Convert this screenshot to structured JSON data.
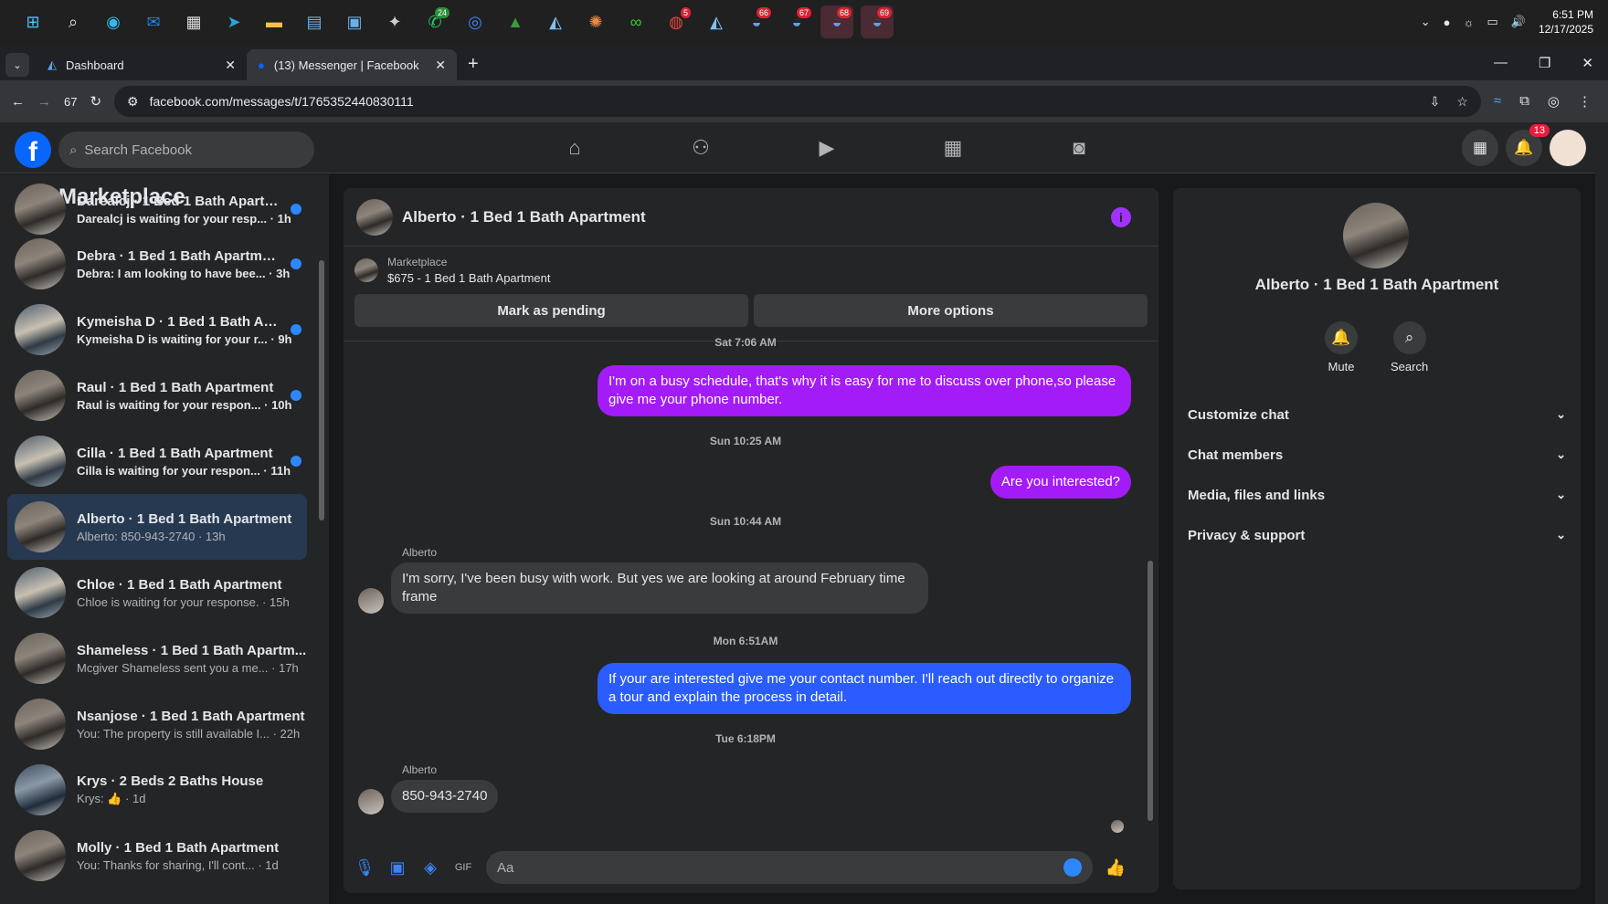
{
  "taskbar": {
    "time": "6:51 PM",
    "date": "12/17/2025",
    "whatsapp_badge": "24",
    "chrome_badge": "5",
    "app_badges": [
      "66",
      "67",
      "68",
      "69"
    ]
  },
  "browser": {
    "tabs": [
      {
        "label": "Dashboard"
      },
      {
        "label": "(13) Messenger | Facebook"
      }
    ],
    "url": "facebook.com/messages/t/1765352440830111",
    "counter": "67"
  },
  "facebook": {
    "search_placeholder": "Search Facebook",
    "notifications_count": "13"
  },
  "sidebar": {
    "title": "Marketplace",
    "items": [
      {
        "title": "Darealcj · 1 Bed 1 Bath Apartm...",
        "sub": "Darealcj is waiting for your resp... · 1h",
        "unread": true
      },
      {
        "title": "Debra · 1 Bed 1 Bath Apartment",
        "sub": "Debra: I am looking to have bee... · 3h",
        "unread": true
      },
      {
        "title": "Kymeisha D · 1 Bed 1 Bath Apa...",
        "sub": "Kymeisha D is waiting for your r... · 9h",
        "unread": true
      },
      {
        "title": "Raul · 1 Bed 1 Bath Apartment",
        "sub": "Raul is waiting for your respon... · 10h",
        "unread": true
      },
      {
        "title": "Cilla · 1 Bed 1 Bath Apartment",
        "sub": "Cilla is waiting for your respon... · 11h",
        "unread": true
      },
      {
        "title": "Alberto · 1 Bed 1 Bath Apartment",
        "sub": "Alberto: 850-943-2740 · 13h",
        "unread": false
      },
      {
        "title": "Chloe · 1 Bed 1 Bath Apartment",
        "sub": "Chloe is waiting for your response. · 15h",
        "unread": false
      },
      {
        "title": "Shameless · 1 Bed 1 Bath Apartm...",
        "sub": "Mcgiver Shameless sent you a me... · 17h",
        "unread": false
      },
      {
        "title": "Nsanjose · 1 Bed 1 Bath Apartment",
        "sub": "You: The property is still available I... · 22h",
        "unread": false
      },
      {
        "title": "Krys · 2 Beds 2 Baths House",
        "sub": "Krys: 👍 · 1d",
        "unread": false
      },
      {
        "title": "Molly · 1 Bed 1 Bath Apartment",
        "sub": "You: Thanks for sharing, I'll cont... · 1d",
        "unread": false
      }
    ]
  },
  "chat": {
    "title": "Alberto · 1 Bed 1 Bath Apartment",
    "listing_label": "Marketplace",
    "listing_price": "$675 - 1 Bed 1 Bath Apartment",
    "mark_pending": "Mark as pending",
    "more_options": "More options",
    "timestamps": [
      "Sat 7:06 AM",
      "Sun 10:25 AM",
      "Sun 10:44 AM",
      "Mon 6:51AM",
      "Tue 6:18PM"
    ],
    "messages": [
      "I'm on a busy schedule, that's why it is easy for me to discuss over phone,so please give me your phone number.",
      "Are you interested?",
      "I'm sorry, I've been busy with work. But yes we are looking at around February time frame",
      "If your are interested give me your contact number. I'll reach out directly to organize a tour and explain the process in detail.",
      "850-943-2740"
    ],
    "sender_name": "Alberto",
    "composer_placeholder": "Aa"
  },
  "details": {
    "name": "Alberto · 1 Bed 1 Bath Apartment",
    "mute": "Mute",
    "search": "Search",
    "sections": [
      "Customize chat",
      "Chat members",
      "Media, files and links",
      "Privacy & support"
    ]
  },
  "colors": {
    "accent_purple": "#a31bf6",
    "accent_blue": "#2a5cff",
    "fb_blue": "#0866ff"
  }
}
